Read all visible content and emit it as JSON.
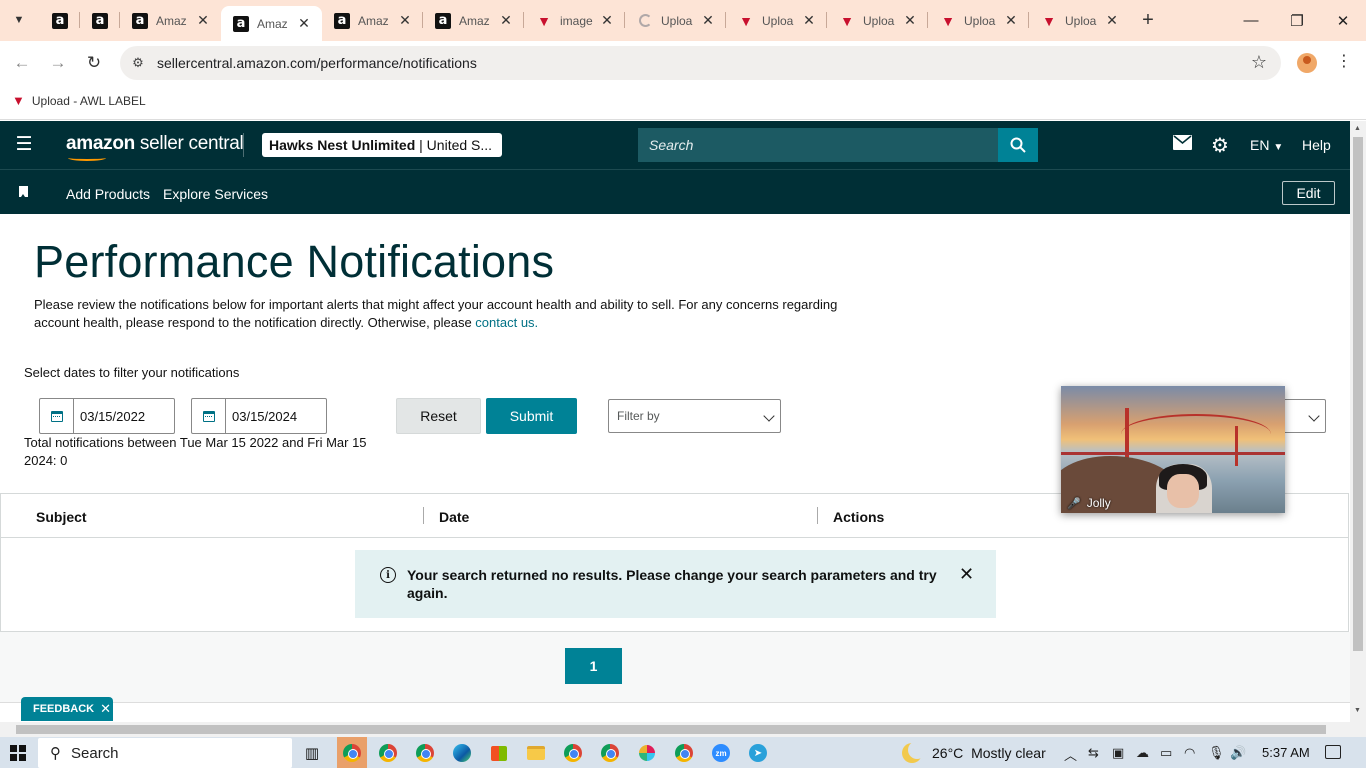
{
  "browser": {
    "tabs": [
      {
        "title": "",
        "icon": "amazon-icon",
        "active": false
      },
      {
        "title": "",
        "icon": "amazon-icon",
        "active": false
      },
      {
        "title": "Amaz",
        "icon": "amazon-icon",
        "active": false
      },
      {
        "title": "Amaz",
        "icon": "amazon-icon",
        "active": true
      },
      {
        "title": "Amaz",
        "icon": "amazon-icon",
        "active": false
      },
      {
        "title": "Amaz",
        "icon": "amazon-icon",
        "active": false
      },
      {
        "title": "image",
        "icon": "awl-icon",
        "active": false
      },
      {
        "title": "Uploa",
        "icon": "loading-icon",
        "active": false
      },
      {
        "title": "Uploa",
        "icon": "awl-icon",
        "active": false
      },
      {
        "title": "Uploa",
        "icon": "awl-icon",
        "active": false
      },
      {
        "title": "Uploa",
        "icon": "awl-icon",
        "active": false
      },
      {
        "title": "Uploa",
        "icon": "awl-icon",
        "active": false
      }
    ],
    "url": "sellercentral.amazon.com/performance/notifications",
    "bookmark": "Upload - AWL LABEL"
  },
  "header": {
    "logo_a": "amazon",
    "logo_b": " seller central",
    "account_name": "Hawks Nest Unlimited",
    "account_region": " | United S...",
    "search_placeholder": "Search",
    "lang": "EN",
    "help": "Help",
    "nav": [
      "Add Products",
      "Explore Services"
    ],
    "edit": "Edit"
  },
  "page": {
    "title": "Performance Notifications",
    "intro": "Please review the notifications below for important alerts that might affect your account health and ability to sell. For any concerns regarding account health, please respond to the notification directly. Otherwise, please ",
    "contact_link": "contact us.",
    "filter_label": "Select dates to filter your notifications",
    "start_date": "03/15/2022",
    "end_date": "03/15/2024",
    "reset": "Reset",
    "submit": "Submit",
    "filter_by": "Filter by",
    "total": "Total notifications between Tue Mar 15 2022 and Fri Mar 15 2024: 0",
    "columns": [
      "Subject",
      "Date",
      "Actions"
    ],
    "alert": "Your search returned no results. Please change your search parameters and try again.",
    "page_number": "1",
    "feedback": "FEEDBACK"
  },
  "video": {
    "name": "Jolly"
  },
  "taskbar": {
    "search": "Search",
    "temperature": "26°C",
    "weather": "Mostly clear",
    "time": "5:37 AM"
  }
}
